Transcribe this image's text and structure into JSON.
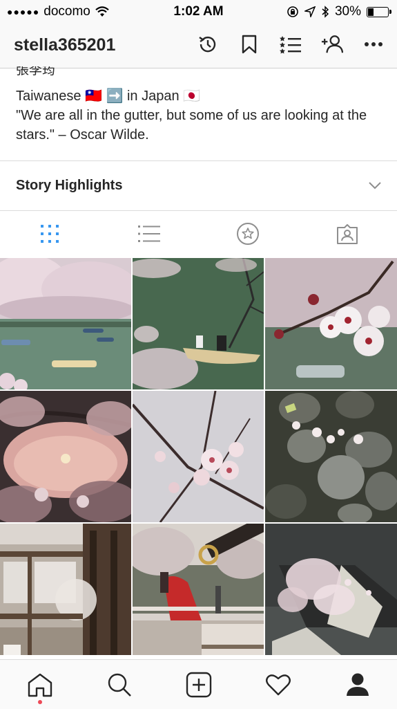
{
  "status_bar": {
    "carrier": "docomo",
    "time": "1:02 AM",
    "battery": "30%",
    "battery_level": 0.3
  },
  "header": {
    "username": "stella365201",
    "icons": [
      "history-icon",
      "bookmark-icon",
      "list-icon",
      "add-user-icon",
      "more-icon"
    ]
  },
  "bio": {
    "name_partial": "張李筠",
    "line1": "Taiwanese 🇹🇼 ➡️ in Japan 🇯🇵",
    "quote": "\"We are all in the gutter, but some of us are looking at the stars.\" – Oscar Wilde."
  },
  "story_highlights": {
    "label": "Story Highlights"
  },
  "view_tabs": [
    {
      "icon": "grid-icon",
      "active": true
    },
    {
      "icon": "list-view-icon",
      "active": false
    },
    {
      "icon": "saved-star-icon",
      "active": false
    },
    {
      "icon": "tagged-icon",
      "active": false
    }
  ],
  "posts": [
    "cherry blossoms over moat with rowboats",
    "rowboat on green water under blossoms",
    "cherry blossom branch closeup",
    "sunset through blossoms",
    "blossoms against sky",
    "petals on stones",
    "shrine with fortune papers",
    "red umbrella and lantern",
    "petals on dark ground"
  ],
  "bottom_tabs": [
    "home-icon",
    "search-icon",
    "add-post-icon",
    "activity-heart-icon",
    "profile-icon"
  ],
  "colors": {
    "accent": "#3897f0",
    "notification": "#ed4956",
    "text": "#262626"
  }
}
